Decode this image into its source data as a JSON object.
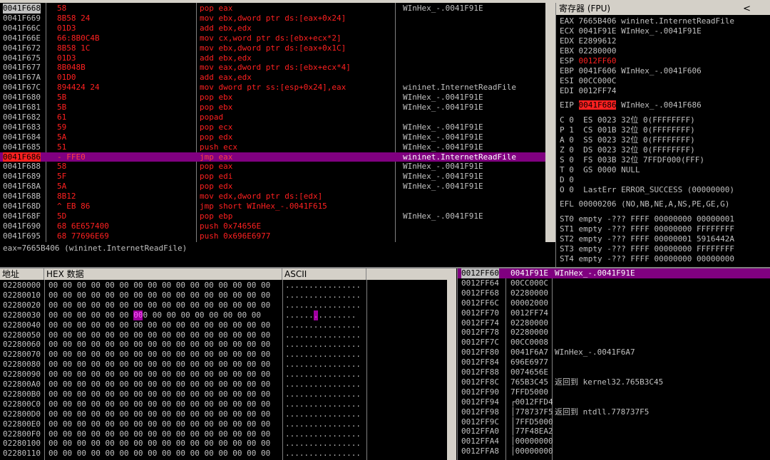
{
  "cpu": {
    "rows": [
      {
        "addr": "0041F668",
        "hex": "58",
        "asm": "pop eax",
        "cmt": "WInHex_-.0041F91E",
        "state": "top"
      },
      {
        "addr": "0041F669",
        "hex": "8B58 24",
        "asm": "mov ebx,dword ptr ds:[eax+0x24]",
        "cmt": "",
        "state": ""
      },
      {
        "addr": "0041F66C",
        "hex": "01D3",
        "asm": "add ebx,edx",
        "cmt": "",
        "state": ""
      },
      {
        "addr": "0041F66E",
        "hex": "66:8B0C4B",
        "asm": "mov cx,word ptr ds:[ebx+ecx*2]",
        "cmt": "",
        "state": ""
      },
      {
        "addr": "0041F672",
        "hex": "8B58 1C",
        "asm": "mov ebx,dword ptr ds:[eax+0x1C]",
        "cmt": "",
        "state": ""
      },
      {
        "addr": "0041F675",
        "hex": "01D3",
        "asm": "add ebx,edx",
        "cmt": "",
        "state": ""
      },
      {
        "addr": "0041F677",
        "hex": "8B048B",
        "asm": "mov eax,dword ptr ds:[ebx+ecx*4]",
        "cmt": "",
        "state": ""
      },
      {
        "addr": "0041F67A",
        "hex": "01D0",
        "asm": "add eax,edx",
        "cmt": "",
        "state": ""
      },
      {
        "addr": "0041F67C",
        "hex": "894424 24",
        "asm": "mov dword ptr ss:[esp+0x24],eax",
        "cmt": "wininet.InternetReadFile",
        "state": ""
      },
      {
        "addr": "0041F680",
        "hex": "5B",
        "asm": "pop ebx",
        "cmt": "WInHex_-.0041F91E",
        "state": ""
      },
      {
        "addr": "0041F681",
        "hex": "5B",
        "asm": "pop ebx",
        "cmt": "WInHex_-.0041F91E",
        "state": ""
      },
      {
        "addr": "0041F682",
        "hex": "61",
        "asm": "popad",
        "cmt": "",
        "state": ""
      },
      {
        "addr": "0041F683",
        "hex": "59",
        "asm": "pop ecx",
        "cmt": "WInHex_-.0041F91E",
        "state": ""
      },
      {
        "addr": "0041F684",
        "hex": "5A",
        "asm": "pop edx",
        "cmt": "WInHex_-.0041F91E",
        "state": ""
      },
      {
        "addr": "0041F685",
        "hex": "51",
        "asm": "push ecx",
        "cmt": "WInHex_-.0041F91E",
        "state": ""
      },
      {
        "addr": "0041F686",
        "hex": "- FFE0",
        "asm": "jmp eax",
        "cmt": "wininet.InternetReadFile",
        "state": "cur"
      },
      {
        "addr": "0041F688",
        "hex": "58",
        "asm": "pop eax",
        "cmt": "WInHex_-.0041F91E",
        "state": ""
      },
      {
        "addr": "0041F689",
        "hex": "5F",
        "asm": "pop edi",
        "cmt": "WInHex_-.0041F91E",
        "state": ""
      },
      {
        "addr": "0041F68A",
        "hex": "5A",
        "asm": "pop edx",
        "cmt": "WInHex_-.0041F91E",
        "state": ""
      },
      {
        "addr": "0041F68B",
        "hex": "8B12",
        "asm": "mov edx,dword ptr ds:[edx]",
        "cmt": "",
        "state": ""
      },
      {
        "addr": "0041F68D",
        "hex": "^ EB 86",
        "asm": "jmp short WInHex_-.0041F615",
        "cmt": "",
        "state": ""
      },
      {
        "addr": "0041F68F",
        "hex": "5D",
        "asm": "pop ebp",
        "cmt": "WInHex_-.0041F91E",
        "state": ""
      },
      {
        "addr": "0041F690",
        "hex": "68 6E657400",
        "asm": "push 0x74656E",
        "cmt": "",
        "state": ""
      },
      {
        "addr": "0041F695",
        "hex": "68 77696E69",
        "asm": "push 0x696E6977",
        "cmt": "",
        "state": ""
      }
    ],
    "info_text": "eax=7665B406 (wininet.InternetReadFile)"
  },
  "registers": {
    "title": "寄存器 (FPU)",
    "chevron": "<",
    "gp": [
      {
        "name": "EAX",
        "value": "7665B406",
        "comment": "wininet.InternetReadFile",
        "changed": false
      },
      {
        "name": "ECX",
        "value": "0041F91E",
        "comment": "WInHex_-.0041F91E",
        "changed": false
      },
      {
        "name": "EDX",
        "value": "E2899612",
        "comment": "",
        "changed": false
      },
      {
        "name": "EBX",
        "value": "02280000",
        "comment": "",
        "changed": false
      },
      {
        "name": "ESP",
        "value": "0012FF60",
        "comment": "",
        "changed": true
      },
      {
        "name": "EBP",
        "value": "0041F606",
        "comment": "WInHex_-.0041F606",
        "changed": false
      },
      {
        "name": "ESI",
        "value": "00CC000C",
        "comment": "",
        "changed": false
      },
      {
        "name": "EDI",
        "value": "0012FF74",
        "comment": "",
        "changed": false
      }
    ],
    "eip": {
      "name": "EIP",
      "value": "0041F686",
      "comment": "WInHex_-.0041F686"
    },
    "flags": [
      "C 0  ES 0023 32位 0(FFFFFFFF)",
      "P 1  CS 001B 32位 0(FFFFFFFF)",
      "A 0  SS 0023 32位 0(FFFFFFFF)",
      "Z 0  DS 0023 32位 0(FFFFFFFF)",
      "S 0  FS 003B 32位 7FFDF000(FFF)",
      "T 0  GS 0000 NULL",
      "D 0",
      "O 0  LastErr ERROR_SUCCESS (00000000)"
    ],
    "efl": "EFL 00000206 (NO,NB,NE,A,NS,PE,GE,G)",
    "fpu": [
      "ST0 empty -??? FFFF 00000000 00000001",
      "ST1 empty -??? FFFF 00000000 FFFFFFFF",
      "ST2 empty -??? FFFF 00000001 5916442A",
      "ST3 empty -??? FFFF 00000000 FFFFFFFF",
      "ST4 empty -??? FFFF 00000000 00000000"
    ]
  },
  "dump": {
    "col_addr": "地址",
    "col_hex": "HEX 数据",
    "col_ascii": "ASCII",
    "rows": [
      {
        "addr": "02280000",
        "hex": "00 00 00 00 00 00 00 00 00 00 00 00 00 00 00 00",
        "ascii": "................",
        "hl": false
      },
      {
        "addr": "02280010",
        "hex": "00 00 00 00 00 00 00 00 00 00 00 00 00 00 00 00",
        "ascii": "................",
        "hl": false
      },
      {
        "addr": "02280020",
        "hex": "00 00 00 00 00 00 00 00 00 00 00 00 00 00 00 00",
        "ascii": "................",
        "hl": false
      },
      {
        "addr": "02280030",
        "hex_a": "00 00 00 00 00 00 ",
        "hex_b": "00",
        "hex_c": " 00 00 00 00 00 00 00 00 00",
        "ascii_a": "......",
        "ascii_b": ".",
        "ascii_c": ".........",
        "hl": true
      },
      {
        "addr": "02280040",
        "hex": "00 00 00 00 00 00 00 00 00 00 00 00 00 00 00 00",
        "ascii": "................",
        "hl": false
      },
      {
        "addr": "02280050",
        "hex": "00 00 00 00 00 00 00 00 00 00 00 00 00 00 00 00",
        "ascii": "................",
        "hl": false
      },
      {
        "addr": "02280060",
        "hex": "00 00 00 00 00 00 00 00 00 00 00 00 00 00 00 00",
        "ascii": "................",
        "hl": false
      },
      {
        "addr": "02280070",
        "hex": "00 00 00 00 00 00 00 00 00 00 00 00 00 00 00 00",
        "ascii": "................",
        "hl": false
      },
      {
        "addr": "02280080",
        "hex": "00 00 00 00 00 00 00 00 00 00 00 00 00 00 00 00",
        "ascii": "................",
        "hl": false
      },
      {
        "addr": "02280090",
        "hex": "00 00 00 00 00 00 00 00 00 00 00 00 00 00 00 00",
        "ascii": "................",
        "hl": false
      },
      {
        "addr": "022800A0",
        "hex": "00 00 00 00 00 00 00 00 00 00 00 00 00 00 00 00",
        "ascii": "................",
        "hl": false
      },
      {
        "addr": "022800B0",
        "hex": "00 00 00 00 00 00 00 00 00 00 00 00 00 00 00 00",
        "ascii": "................",
        "hl": false
      },
      {
        "addr": "022800C0",
        "hex": "00 00 00 00 00 00 00 00 00 00 00 00 00 00 00 00",
        "ascii": "................",
        "hl": false
      },
      {
        "addr": "022800D0",
        "hex": "00 00 00 00 00 00 00 00 00 00 00 00 00 00 00 00",
        "ascii": "................",
        "hl": false
      },
      {
        "addr": "022800E0",
        "hex": "00 00 00 00 00 00 00 00 00 00 00 00 00 00 00 00",
        "ascii": "................",
        "hl": false
      },
      {
        "addr": "022800F0",
        "hex": "00 00 00 00 00 00 00 00 00 00 00 00 00 00 00 00",
        "ascii": "................",
        "hl": false
      },
      {
        "addr": "02280100",
        "hex": "00 00 00 00 00 00 00 00 00 00 00 00 00 00 00 00",
        "ascii": "................",
        "hl": false
      },
      {
        "addr": "02280110",
        "hex": "00 00 00 00 00 00 00 00 00 00 00 00 00 00 00 00",
        "ascii": "................",
        "hl": false
      }
    ]
  },
  "stack": {
    "rows": [
      {
        "addr": "0012FF60",
        "val": "0041F91E",
        "cmt": "WInHex_-.0041F91E",
        "cur": true
      },
      {
        "addr": "0012FF64",
        "val": "00CC000C",
        "cmt": "",
        "cur": false
      },
      {
        "addr": "0012FF68",
        "val": "02280000",
        "cmt": "",
        "cur": false
      },
      {
        "addr": "0012FF6C",
        "val": "00002000",
        "cmt": "",
        "cur": false
      },
      {
        "addr": "0012FF70",
        "val": "0012FF74",
        "cmt": "",
        "cur": false
      },
      {
        "addr": "0012FF74",
        "val": "02280000",
        "cmt": "",
        "cur": false
      },
      {
        "addr": "0012FF78",
        "val": "02280000",
        "cmt": "",
        "cur": false
      },
      {
        "addr": "0012FF7C",
        "val": "00CC0008",
        "cmt": "",
        "cur": false
      },
      {
        "addr": "0012FF80",
        "val": "0041F6A7",
        "cmt": "WInHex_-.0041F6A7",
        "cur": false
      },
      {
        "addr": "0012FF84",
        "val": "696E6977",
        "cmt": "",
        "cur": false
      },
      {
        "addr": "0012FF88",
        "val": "0074656E",
        "cmt": "",
        "cur": false
      },
      {
        "addr": "0012FF8C",
        "val": "765B3C45",
        "cmt": "返回到 kernel32.765B3C45",
        "cur": false
      },
      {
        "addr": "0012FF90",
        "val": "7FFD5000",
        "cmt": "",
        "cur": false
      },
      {
        "addr": "0012FF94",
        "val": "┌0012FFD4",
        "cmt": "",
        "cur": false
      },
      {
        "addr": "0012FF98",
        "val": "│778737F5",
        "cmt": "返回到 ntdll.778737F5",
        "cur": false
      },
      {
        "addr": "0012FF9C",
        "val": "│7FFD5000",
        "cmt": "",
        "cur": false
      },
      {
        "addr": "0012FFA0",
        "val": "│77F48EA2",
        "cmt": "",
        "cur": false
      },
      {
        "addr": "0012FFA4",
        "val": "│00000000",
        "cmt": "",
        "cur": false
      },
      {
        "addr": "0012FFA8",
        "val": "│00000000",
        "cmt": "",
        "cur": false
      }
    ]
  },
  "colors": {
    "accent_red": "#ff2020",
    "highlight_purple": "#800080",
    "panel_bg": "#000000",
    "chrome": "#d4d0c8"
  }
}
